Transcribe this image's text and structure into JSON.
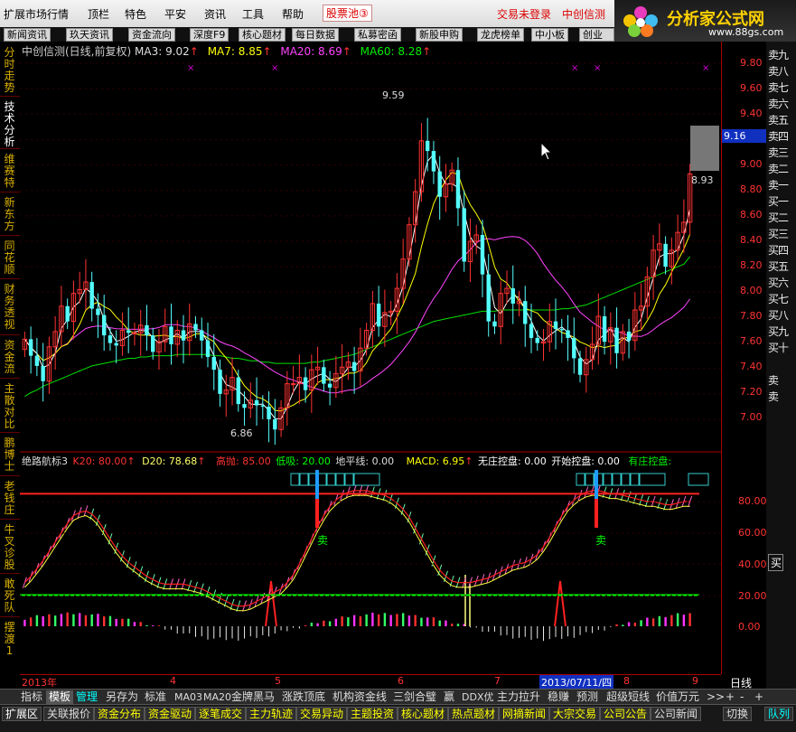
{
  "menu": {
    "items": [
      "扩展市场行情",
      "顶栏",
      "特色",
      "平安",
      "资讯",
      "工具",
      "帮助"
    ],
    "pool_label": "股票池",
    "pool_badge": "③",
    "trade_status": "交易未登录",
    "stock_title": "中创信测"
  },
  "logo": {
    "title": "分析家公式网",
    "url_text": "www.88gs.com"
  },
  "nav": [
    "新闻资讯",
    "玖天资讯",
    "资金流向",
    "深度F9",
    "核心题材",
    "每日数据",
    "私募密函",
    "新股申购",
    "龙虎榜单",
    "中小板",
    "创业板"
  ],
  "left_tabs": [
    {
      "label": "分时走势"
    },
    {
      "label": "技术分析"
    },
    {
      "label": "维赛特"
    },
    {
      "label": "新东方"
    },
    {
      "label": "同花顺"
    },
    {
      "label": "财务透视"
    },
    {
      "label": "资金流"
    },
    {
      "label": "主散对比"
    },
    {
      "label": "鹏博士"
    },
    {
      "label": "老钱庄"
    },
    {
      "label": "牛叉诊股"
    },
    {
      "label": "敢死队"
    },
    {
      "label": "摆渡1"
    }
  ],
  "main_header": {
    "title": "中创信测(日线,前复权)",
    "ma3": "MA3: 9.02",
    "ma7": "MA7: 8.85",
    "ma20": "MA20: 8.69",
    "ma60": "MA60: 8.28",
    "arrow": "↑"
  },
  "price_axis": [
    "9.80",
    "9.60",
    "9.40",
    "9.20",
    "9.00",
    "8.80",
    "8.60",
    "8.40",
    "8.20",
    "8.00",
    "7.80",
    "7.60",
    "7.40",
    "7.20",
    "7.00"
  ],
  "current_price": "9.16",
  "annotations": {
    "high": "9.59",
    "low": "6.86",
    "last": "8.93"
  },
  "indicator_header": {
    "name": "绝路航标3",
    "k20": "K20: 80.00",
    "d20": "D20: 78.68",
    "high_throw": "高抛: 85.00",
    "low_absorb": "低吸: 20.00",
    "ground": "地平线: 0.00",
    "macd": "MACD: 6.95",
    "no_control": "无庄控盘: 0.00",
    "start_control": "开始控盘: 0.00",
    "has_control": "有庄控盘:",
    "arrow": "↑"
  },
  "indicator_axis": [
    "80.00",
    "60.00",
    "40.00",
    "20.00",
    "0.00"
  ],
  "sell_label": "卖",
  "buysell_labels": [
    "卖九",
    "卖八",
    "卖七",
    "卖六",
    "卖五",
    "卖四",
    "卖三",
    "卖二",
    "卖一",
    "买一",
    "买二",
    "买三",
    "买四",
    "买五",
    "买六",
    "买七",
    "买八",
    "买九",
    "买十",
    "卖",
    "卖"
  ],
  "buysell_lower": "买",
  "date_axis": {
    "labels": [
      "2013年",
      "4",
      "5",
      "6",
      "7",
      "8",
      "9"
    ],
    "highlight": "2013/07/11/四",
    "period": "日线"
  },
  "bottom_tabs1": [
    "指标",
    "模板",
    "管理",
    "另存为",
    "标准",
    "MA03",
    "MA20",
    "金牌黑马",
    "涨跌顶底",
    "机构资金线",
    "三剑合璧",
    "赢",
    "DDX优",
    "主力拉升",
    "稳赚",
    "预测",
    "超级短线",
    "价值万元",
    ">>",
    "+",
    "-",
    "+"
  ],
  "bottom_tabs2": [
    "扩展区",
    "关联报价",
    "资金分布",
    "资金驱动",
    "逐笔成交",
    "主力轨迹",
    "交易异动",
    "主题投资",
    "核心题材",
    "热点题材",
    "网摘新闻",
    "大宗交易",
    "公司公告",
    "公司新闻",
    "切换",
    "队列"
  ],
  "colors": {
    "up": "#ff3232",
    "down": "#54ffff",
    "ma3": "#ffffff",
    "ma7": "#ffff00",
    "ma20": "#ff44ff",
    "ma60": "#00e000",
    "k_line": "#ff2020",
    "d_line": "#ffff40",
    "low_line": "#00ff00",
    "high_line": "#ff2020"
  },
  "chart_data": {
    "type": "candlestick",
    "title": "中创信测(日线,前复权)",
    "ylim": [
      6.7,
      9.9
    ],
    "series_count": 110,
    "open": [
      7.55,
      7.63,
      7.5,
      7.42,
      7.3,
      7.57,
      7.69,
      7.89,
      7.77,
      7.99,
      8.02,
      8.08,
      7.87,
      7.82,
      7.66,
      7.6,
      7.58,
      7.7,
      7.68,
      7.68,
      7.74,
      7.66,
      7.53,
      7.61,
      7.73,
      7.59,
      7.7,
      7.62,
      7.75,
      7.7,
      7.62,
      7.49,
      7.39,
      7.2,
      7.23,
      7.33,
      7.12,
      7.09,
      7.15,
      7.11,
      7.1,
      7.0,
      6.92,
      7.09,
      7.28,
      7.28,
      7.33,
      7.23,
      7.39,
      7.41,
      7.28,
      7.25,
      7.36,
      7.41,
      7.45,
      7.38,
      7.56,
      7.7,
      7.91,
      7.73,
      7.84,
      7.85,
      8.03,
      8.26,
      8.53,
      8.79,
      9.19,
      9.11,
      8.95,
      8.75,
      8.85,
      8.96,
      8.66,
      8.24,
      8.4,
      8.45,
      8.14,
      7.77,
      7.73,
      7.99,
      8.03,
      7.91,
      7.93,
      7.75,
      7.64,
      7.6,
      7.61,
      7.77,
      7.71,
      7.7,
      7.64,
      7.48,
      7.35,
      7.47,
      7.59,
      7.81,
      7.61,
      7.72,
      7.52,
      7.69,
      7.62,
      7.86,
      7.89,
      8.12,
      8.33,
      8.38,
      8.2,
      8.33,
      8.47,
      8.55
    ],
    "close": [
      7.63,
      7.5,
      7.42,
      7.3,
      7.57,
      7.69,
      7.89,
      7.77,
      7.99,
      8.02,
      8.08,
      7.87,
      7.82,
      7.66,
      7.6,
      7.58,
      7.7,
      7.68,
      7.68,
      7.74,
      7.66,
      7.53,
      7.61,
      7.73,
      7.59,
      7.7,
      7.62,
      7.75,
      7.7,
      7.62,
      7.49,
      7.39,
      7.2,
      7.23,
      7.33,
      7.12,
      7.09,
      7.15,
      7.11,
      7.1,
      7.0,
      6.92,
      7.09,
      7.28,
      7.28,
      7.33,
      7.23,
      7.39,
      7.41,
      7.28,
      7.25,
      7.36,
      7.41,
      7.45,
      7.38,
      7.56,
      7.7,
      7.91,
      7.73,
      7.84,
      7.85,
      8.03,
      8.26,
      8.53,
      8.79,
      9.19,
      9.11,
      8.95,
      8.75,
      8.85,
      8.96,
      8.66,
      8.24,
      8.4,
      8.45,
      8.14,
      7.77,
      7.73,
      7.99,
      8.03,
      7.91,
      7.93,
      7.75,
      7.64,
      7.6,
      7.61,
      7.77,
      7.71,
      7.7,
      7.64,
      7.48,
      7.35,
      7.47,
      7.59,
      7.81,
      7.61,
      7.72,
      7.52,
      7.69,
      7.62,
      7.86,
      7.89,
      8.12,
      8.33,
      8.38,
      8.2,
      8.33,
      8.47,
      8.55,
      8.93
    ],
    "ma60_points": [
      7.18,
      7.21,
      7.23,
      7.26,
      7.28,
      7.3,
      7.32,
      7.34,
      7.36,
      7.38,
      7.4,
      7.42,
      7.43,
      7.44,
      7.45,
      7.46,
      7.47,
      7.48,
      7.48,
      7.49,
      7.49,
      7.5,
      7.5,
      7.5,
      7.5,
      7.51,
      7.51,
      7.51,
      7.51,
      7.51,
      7.51,
      7.5,
      7.5,
      7.49,
      7.48,
      7.48,
      7.47,
      7.46,
      7.46,
      7.45,
      7.45,
      7.44,
      7.44,
      7.44,
      7.44,
      7.44,
      7.44,
      7.45,
      7.45,
      7.46,
      7.47,
      7.48,
      7.49,
      7.5,
      7.51,
      7.53,
      7.55,
      7.57,
      7.59,
      7.61,
      7.63,
      7.65,
      7.67,
      7.69,
      7.71,
      7.73,
      7.75,
      7.77,
      7.78,
      7.79,
      7.8,
      7.81,
      7.82,
      7.83,
      7.84,
      7.85,
      7.85,
      7.85,
      7.86,
      7.86,
      7.86,
      7.86,
      7.86,
      7.86,
      7.86,
      7.86,
      7.86,
      7.86,
      7.87,
      7.87,
      7.88,
      7.89,
      7.9,
      7.92,
      7.94,
      7.96,
      7.98,
      8.0,
      8.02,
      8.04,
      8.06,
      8.08,
      8.1,
      8.12,
      8.14,
      8.16,
      8.18,
      8.2,
      8.22,
      8.28
    ],
    "k_points": [
      28,
      32,
      37,
      42,
      48,
      54,
      60,
      66,
      71,
      73,
      74,
      72,
      68,
      62,
      56,
      50,
      45,
      41,
      38,
      35,
      32,
      30,
      28,
      27,
      27,
      27,
      27,
      26,
      25,
      24,
      22,
      20,
      18,
      16,
      14,
      13,
      13,
      14,
      16,
      18,
      20,
      22,
      24,
      28,
      33,
      40,
      48,
      56,
      64,
      71,
      77,
      81,
      84,
      86,
      87,
      87,
      87,
      86,
      85,
      84,
      82,
      79,
      75,
      70,
      63,
      56,
      49,
      42,
      36,
      32,
      29,
      28,
      28,
      28,
      29,
      30,
      31,
      33,
      35,
      37,
      39,
      40,
      41,
      43,
      46,
      51,
      57,
      64,
      71,
      77,
      81,
      84,
      86,
      87,
      87,
      86,
      85,
      85,
      84,
      83,
      82,
      81,
      80,
      80,
      79,
      78,
      78,
      79,
      80,
      80
    ]
  }
}
